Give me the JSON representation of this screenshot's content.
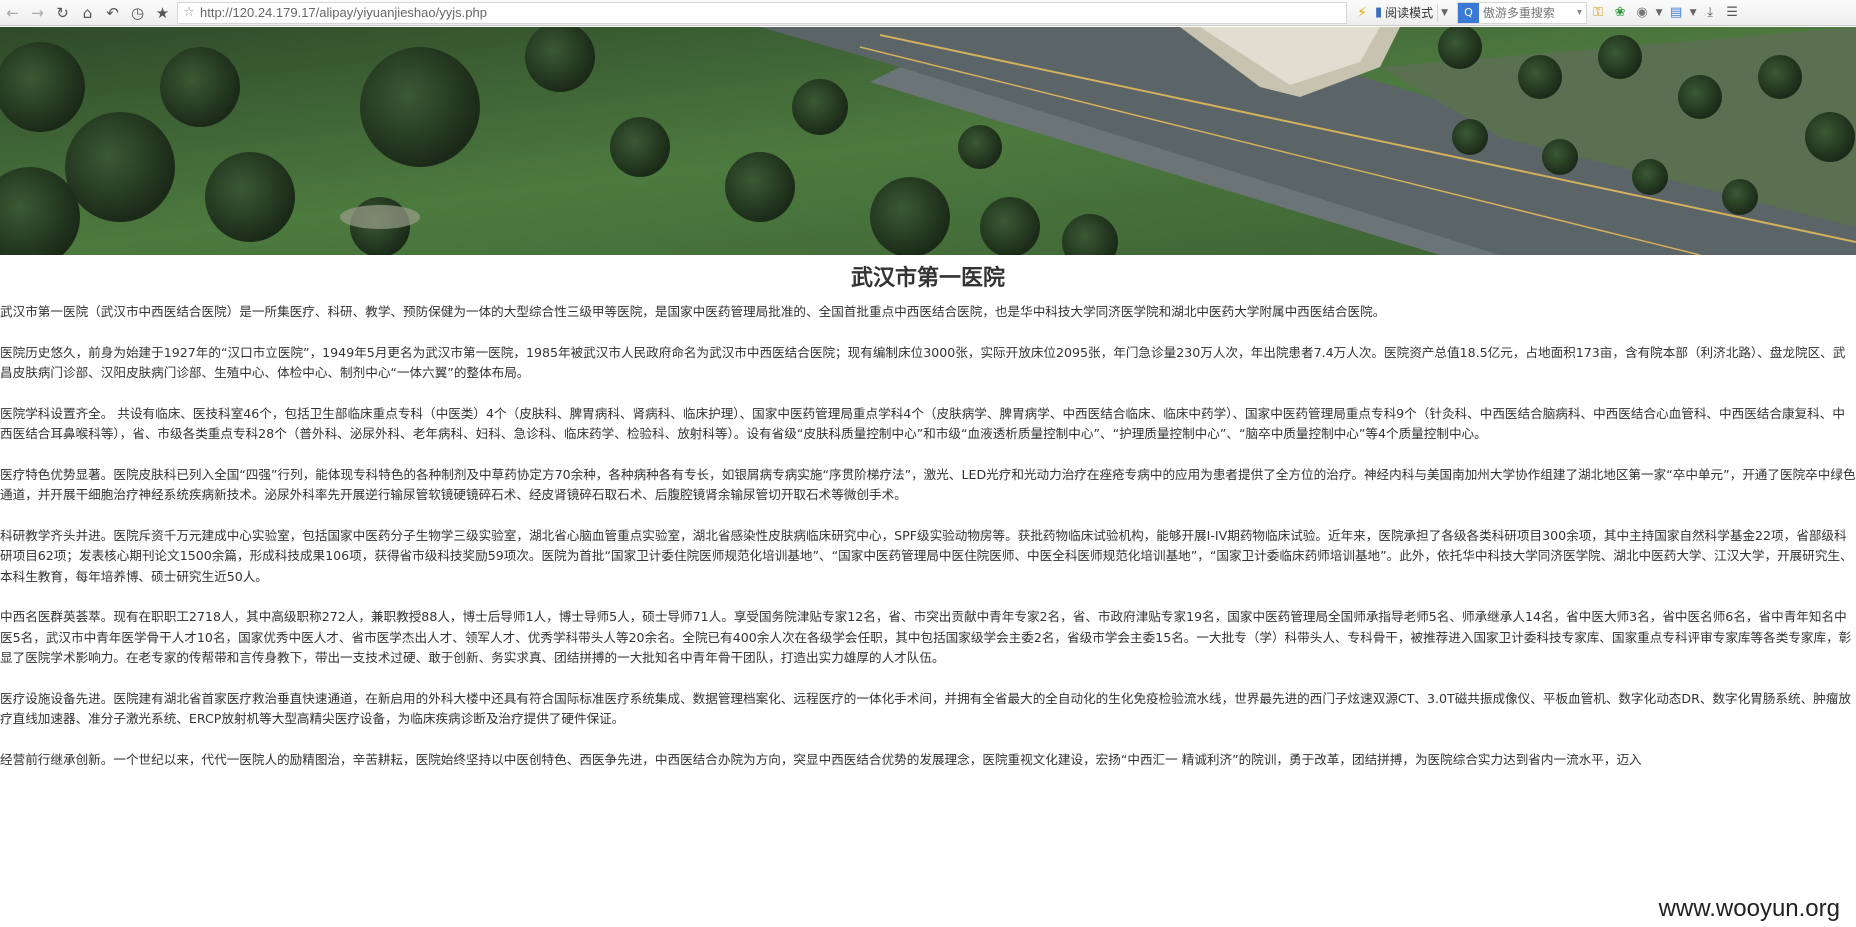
{
  "toolbar": {
    "back_icon": "arrow-left-icon",
    "forward_icon": "arrow-right-icon",
    "url": "http://120.24.179.17/alipay/yiyuanjieshao/yyjs.php",
    "read_mode_label": "阅读模式",
    "search_placeholder": "傲游多重搜索"
  },
  "page": {
    "title": "武汉市第一医院",
    "paragraphs": [
      "武汉市第一医院（武汉市中西医结合医院）是一所集医疗、科研、教学、预防保健为一体的大型综合性三级甲等医院，是国家中医药管理局批准的、全国首批重点中西医结合医院，也是华中科技大学同济医学院和湖北中医药大学附属中西医结合医院。",
      "医院历史悠久，前身为始建于1927年的“汉口市立医院”，1949年5月更名为武汉市第一医院，1985年被武汉市人民政府命名为武汉市中西医结合医院；现有编制床位3000张，实际开放床位2095张，年门急诊量230万人次，年出院患者7.4万人次。医院资产总值18.5亿元，占地面积173亩，含有院本部（利济北路）、盘龙院区、武昌皮肤病门诊部、汉阳皮肤病门诊部、生殖中心、体检中心、制剂中心“一体六翼”的整体布局。",
      "医院学科设置齐全。 共设有临床、医技科室46个，包括卫生部临床重点专科（中医类）4个（皮肤科、脾胃病科、肾病科、临床护理）、国家中医药管理局重点学科4个（皮肤病学、脾胃病学、中西医结合临床、临床中药学）、国家中医药管理局重点专科9个（针灸科、中西医结合脑病科、中西医结合心血管科、中西医结合康复科、中西医结合耳鼻喉科等），省、市级各类重点专科28个（普外科、泌尿外科、老年病科、妇科、急诊科、临床药学、检验科、放射科等）。设有省级“皮肤科质量控制中心”和市级“血液透析质量控制中心”、“护理质量控制中心”、“脑卒中质量控制中心”等4个质量控制中心。",
      "医疗特色优势显著。医院皮肤科已列入全国“四强”行列，能体现专科特色的各种制剂及中草药协定方70余种，各种病种各有专长，如银屑病专病实施“序贯阶梯疗法”，激光、LED光疗和光动力治疗在痤疮专病中的应用为患者提供了全方位的治疗。神经内科与美国南加州大学协作组建了湖北地区第一家“卒中单元”，开通了医院卒中绿色通道，并开展干细胞治疗神经系统疾病新技术。泌尿外科率先开展逆行输尿管软镜硬镜碎石术、经皮肾镜碎石取石术、后腹腔镜肾余输尿管切开取石术等微创手术。",
      "科研教学齐头并进。医院斥资千万元建成中心实验室，包括国家中医药分子生物学三级实验室，湖北省心脑血管重点实验室，湖北省感染性皮肤病临床研究中心，SPF级实验动物房等。获批药物临床试验机构，能够开展I-IV期药物临床试验。近年来，医院承担了各级各类科研项目300余项，其中主持国家自然科学基金22项，省部级科研项目62项；发表核心期刊论文1500余篇，形成科技成果106项，获得省市级科技奖励59项次。医院为首批“国家卫计委住院医师规范化培训基地”、“国家中医药管理局中医住院医师、中医全科医师规范化培训基地”，“国家卫计委临床药师培训基地”。此外，依托华中科技大学同济医学院、湖北中医药大学、江汉大学，开展研究生、本科生教育，每年培养博、硕士研究生近50人。",
      "中西名医群英荟萃。现有在职职工2718人，其中高级职称272人，兼职教授88人，博士后导师1人，博士导师5人，硕士导师71人。享受国务院津贴专家12名，省、市突出贡献中青年专家2名，省、市政府津贴专家19名，国家中医药管理局全国师承指导老师5名、师承继承人14名，省中医大师3名，省中医名师6名，省中青年知名中医5名，武汉市中青年医学骨干人才10名，国家优秀中医人才、省市医学杰出人才、领军人才、优秀学科带头人等20余名。全院已有400余人次在各级学会任职，其中包括国家级学会主委2名，省级市学会主委15名。一大批专（学）科带头人、专科骨干，被推荐进入国家卫计委科技专家库、国家重点专科评审专家库等各类专家库，彰显了医院学术影响力。在老专家的传帮带和言传身教下，带出一支技术过硬、敢于创新、务实求真、团结拼搏的一大批知名中青年骨干团队，打造出实力雄厚的人才队伍。",
      "医疗设施设备先进。医院建有湖北省首家医疗救治垂直快速通道，在新启用的外科大楼中还具有符合国际标准医疗系统集成、数据管理档案化、远程医疗的一体化手术间，并拥有全省最大的全自动化的生化免疫检验流水线，世界最先进的西门子炫速双源CT、3.0T磁共振成像仪、平板血管机、数字化动态DR、数字化胃肠系统、肿瘤放疗直线加速器、准分子激光系统、ERCP放射机等大型高精尖医疗设备，为临床疾病诊断及治疗提供了硬件保证。",
      "经营前行继承创新。一个世纪以来，代代一医院人的励精图治，辛苦耕耘，医院始终坚持以中医创特色、西医争先进，中西医结合办院为方向，突显中西医结合优势的发展理念，医院重视文化建设，宏扬“中西汇一 精诚利济”的院训，勇于改革，团结拼搏，为医院综合实力达到省内一流水平，迈入"
    ]
  },
  "watermark": "www.wooyun.org",
  "colors": {
    "text": "#333333",
    "accent_blue": "#3a7ad6",
    "bolt": "#f4a300"
  }
}
